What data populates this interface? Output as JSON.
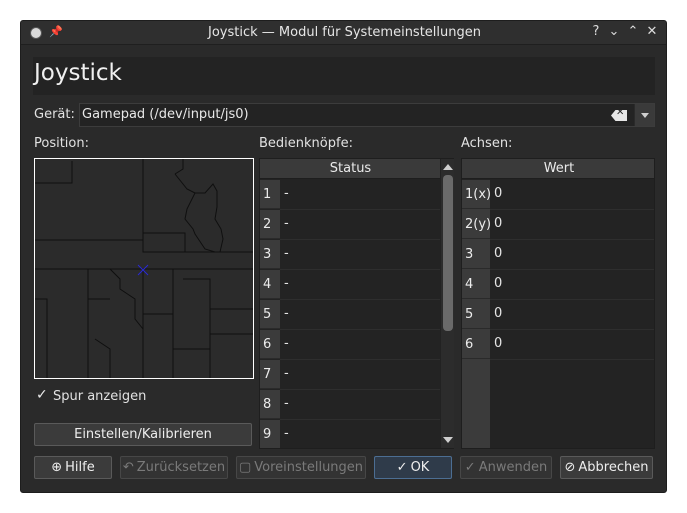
{
  "window": {
    "title": "Joystick — Modul für Systemeinstellungen",
    "buttons": {
      "help": "?",
      "minimize": "⌄",
      "maximize": "⌃",
      "close": "✕"
    }
  },
  "page": {
    "title": "Joystick"
  },
  "device": {
    "label": "Gerät:",
    "value": "Gamepad (/dev/input/js0)"
  },
  "position": {
    "label": "Position:",
    "show_trace_label": "Spur anzeigen",
    "show_trace_checked": true
  },
  "buttons_section": {
    "label": "Bedienknöpfe:",
    "column": "Status",
    "rows": [
      {
        "num": "1",
        "status": "-"
      },
      {
        "num": "2",
        "status": "-"
      },
      {
        "num": "3",
        "status": "-"
      },
      {
        "num": "4",
        "status": "-"
      },
      {
        "num": "5",
        "status": "-"
      },
      {
        "num": "6",
        "status": "-"
      },
      {
        "num": "7",
        "status": "-"
      },
      {
        "num": "8",
        "status": "-"
      },
      {
        "num": "9",
        "status": "-"
      }
    ]
  },
  "axes_section": {
    "label": "Achsen:",
    "column": "Wert",
    "rows": [
      {
        "num": "1(x)",
        "value": "0"
      },
      {
        "num": "2(y)",
        "value": "0"
      },
      {
        "num": "3",
        "value": "0"
      },
      {
        "num": "4",
        "value": "0"
      },
      {
        "num": "5",
        "value": "0"
      },
      {
        "num": "6",
        "value": "0"
      }
    ]
  },
  "calibrate_button": "Einstellen/Kalibrieren",
  "footer": {
    "help": "Hilfe",
    "reset": "Zurücksetzen",
    "defaults": "Voreinstellungen",
    "ok": "OK",
    "apply": "Anwenden",
    "cancel": "Abbrechen"
  },
  "colors": {
    "crosshair": "#2a2ad6",
    "accent": "#4c6e93"
  }
}
